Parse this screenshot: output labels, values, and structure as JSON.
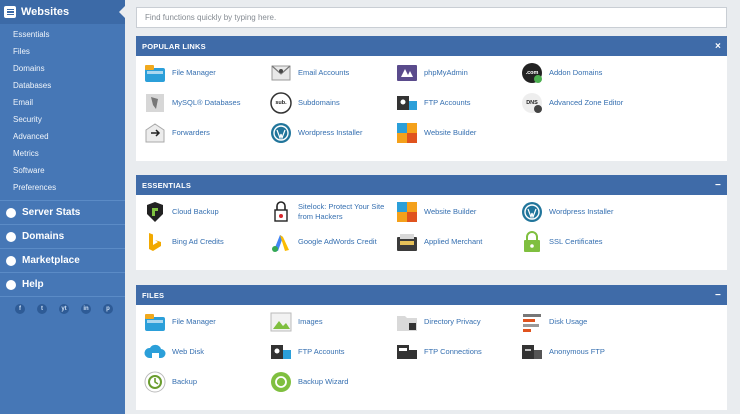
{
  "search": {
    "placeholder": "Find functions quickly by typing here."
  },
  "sidebar": {
    "title": "Websites",
    "items": [
      "Essentials",
      "Files",
      "Domains",
      "Databases",
      "Email",
      "Security",
      "Advanced",
      "Metrics",
      "Software",
      "Preferences"
    ],
    "sections": [
      "Server Stats",
      "Domains",
      "Marketplace",
      "Help"
    ],
    "social": [
      "f",
      "t",
      "yt",
      "in",
      "p"
    ]
  },
  "popular": {
    "title": "POPULAR LINKS",
    "close": "×",
    "items": [
      {
        "label": "File Manager",
        "icon": "file-manager-icon"
      },
      {
        "label": "Email Accounts",
        "icon": "email-accounts-icon"
      },
      {
        "label": "phpMyAdmin",
        "icon": "phpmyadmin-icon"
      },
      {
        "label": "Addon Domains",
        "icon": "addon-domains-icon",
        "badge": ".com"
      },
      {
        "label": "MySQL® Databases",
        "icon": "mysql-databases-icon"
      },
      {
        "label": "Subdomains",
        "icon": "subdomains-icon",
        "badge": "sub."
      },
      {
        "label": "FTP Accounts",
        "icon": "ftp-accounts-icon"
      },
      {
        "label": "Advanced Zone Editor",
        "icon": "zone-editor-icon",
        "badge": "DNS"
      },
      {
        "label": "Forwarders",
        "icon": "forwarders-icon"
      },
      {
        "label": "Wordpress Installer",
        "icon": "wordpress-icon"
      },
      {
        "label": "Website Builder",
        "icon": "website-builder-icon"
      }
    ]
  },
  "essentials": {
    "title": "ESSENTIALS",
    "toggle": "−",
    "items": [
      {
        "label": "Cloud Backup",
        "icon": "cloud-backup-icon"
      },
      {
        "label": "Sitelock: Protect Your Site from Hackers",
        "icon": "sitelock-icon"
      },
      {
        "label": "Website Builder",
        "icon": "website-builder-icon"
      },
      {
        "label": "Wordpress Installer",
        "icon": "wordpress-icon"
      },
      {
        "label": "Bing Ad Credits",
        "icon": "bing-icon"
      },
      {
        "label": "Google AdWords Credit",
        "icon": "adwords-icon"
      },
      {
        "label": "Applied Merchant",
        "icon": "merchant-icon"
      },
      {
        "label": "SSL Certificates",
        "icon": "ssl-icon"
      }
    ]
  },
  "files": {
    "title": "FILES",
    "toggle": "−",
    "items": [
      {
        "label": "File Manager",
        "icon": "file-manager-icon"
      },
      {
        "label": "Images",
        "icon": "images-icon"
      },
      {
        "label": "Directory Privacy",
        "icon": "directory-privacy-icon"
      },
      {
        "label": "Disk Usage",
        "icon": "disk-usage-icon"
      },
      {
        "label": "Web Disk",
        "icon": "web-disk-icon"
      },
      {
        "label": "FTP Accounts",
        "icon": "ftp-accounts-icon"
      },
      {
        "label": "FTP Connections",
        "icon": "ftp-connections-icon"
      },
      {
        "label": "Anonymous FTP",
        "icon": "anonymous-ftp-icon"
      },
      {
        "label": "Backup",
        "icon": "backup-icon"
      },
      {
        "label": "Backup Wizard",
        "icon": "backup-wizard-icon"
      }
    ]
  },
  "colors": {
    "sidebar": "#4677b6",
    "header": "#3f6ba8",
    "link": "#356fb0"
  }
}
